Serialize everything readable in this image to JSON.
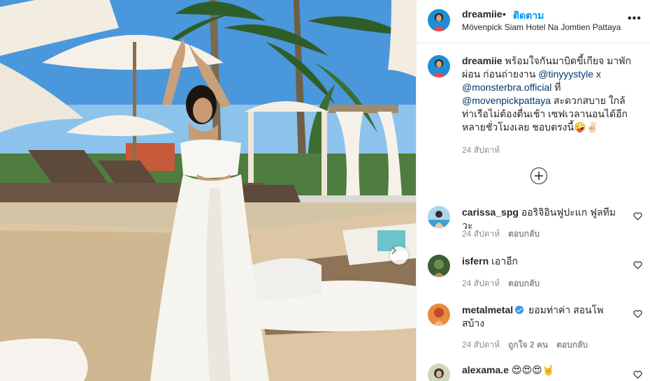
{
  "post": {
    "author": "dreamiie",
    "follow_label": "ติดตาม",
    "separator": "•",
    "location": "Mövenpick Siam Hotel Na Jomtien Pattaya",
    "more_icon": "more-horizontal-icon"
  },
  "caption": {
    "username": "dreamiie",
    "text_1": "พร้อมใจกันมาบิดขี้เกียจ มาพักผ่อน ก่อนถ่ายงาน ",
    "mention_1": "@tinyyystyle",
    "text_2": " x ",
    "mention_2": "@monsterbra.official",
    "text_3": " ที่ ",
    "mention_3": "@movenpickpattaya",
    "text_4": " สะดวกสบาย ใกล้ท่าเรือไม่ต้องตื่นเช้า เซฟเวลานอนได้อีกหลายชั่วโมงเลย ชอบตรงนี้",
    "emoji": "🤪✌🏻",
    "time": "24 สัปดาห์"
  },
  "comments": [
    {
      "username": "carissa_spg",
      "verified": false,
      "text": "ออริจิอินฟูปะแก ฟูลทีมวะ",
      "time": "24 สัปดาห์",
      "likes": "",
      "reply": "ตอบกลับ"
    },
    {
      "username": "isfern",
      "verified": false,
      "text": "เอาอีก",
      "time": "24 สัปดาห์",
      "likes": "",
      "reply": "ตอบกลับ"
    },
    {
      "username": "metalmetal",
      "verified": true,
      "text": "ยอมท่าค่า สอนโพสบ้าง",
      "time": "24 สัปดาห์",
      "likes": "ถูกใจ 2 คน",
      "reply": "ตอบกลับ"
    },
    {
      "username": "alexama.e",
      "verified": false,
      "text": "😍😍😍🤘",
      "time": "",
      "likes": "",
      "reply": ""
    }
  ],
  "colors": {
    "link": "#0095f6",
    "mention": "#00376b",
    "meta": "#8e8e8e",
    "text": "#262626",
    "verified": "#3897f0"
  }
}
